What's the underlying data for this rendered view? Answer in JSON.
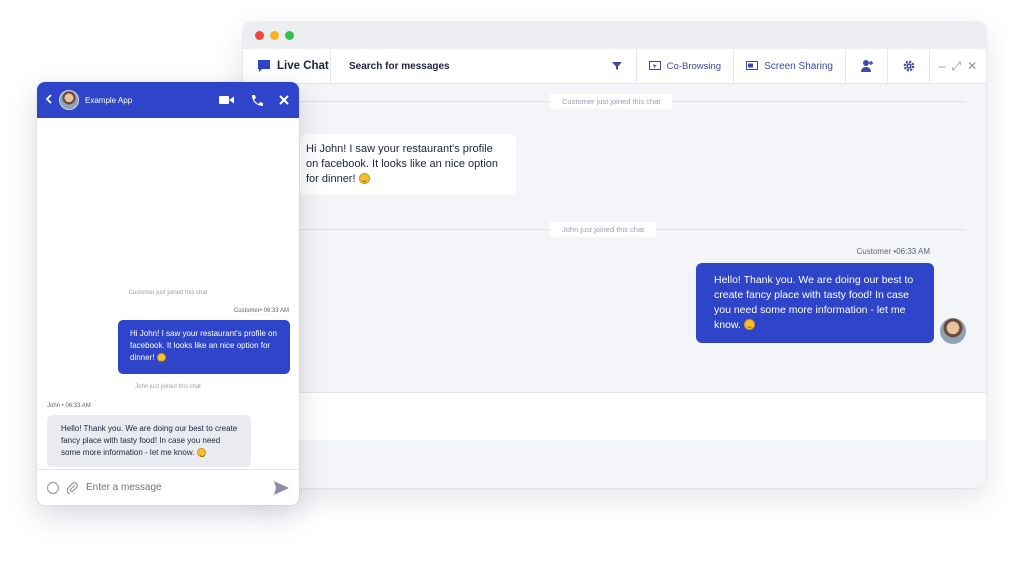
{
  "desktop": {
    "toolbar": {
      "brand_label": "Live Chat",
      "search_label": "Search for messages",
      "cobrowsing_label": "Co-Browsing",
      "screen_sharing_label": "Screen Sharing"
    },
    "system_notes": [
      "Customer just joined this chat",
      "John just joined this chat"
    ],
    "incoming_message": "Hi John! I saw your restaurant's profile on facebook. It looks like an nice option for dinner!",
    "outgoing_meta": "Customer •06:33 AM",
    "outgoing_message": "Hello! Thank you. We are doing our best to create fancy place with tasty food! In case you need some more information - let me know."
  },
  "mobile": {
    "header": {
      "title": "Example App"
    },
    "system_notes": [
      "Customer just joined this chat",
      "John just joined this chat"
    ],
    "customer_meta": "Customer• 06:33 AM",
    "customer_message": "Hi John! I saw your restaurant's profile on facebook. It looks like an nice option for dinner!",
    "agent_meta": "John • 06:33 AM",
    "agent_message": "Hello! Thank you. We are doing our best to create fancy place with tasty food! In case you need some more information - let me know.",
    "composer": {
      "placeholder": "Enter a message"
    }
  },
  "colors": {
    "accent": "#2f45c9",
    "window_bg": "#f4f5f8",
    "incoming_bubble": "#e9ebf0"
  },
  "icons": [
    "chat-icon",
    "filter-icon",
    "cobrowsing-icon",
    "screen-sharing-icon",
    "add-user-icon",
    "gear-icon",
    "minimize-icon",
    "expand-icon",
    "close-icon",
    "back-icon",
    "video-icon",
    "phone-icon",
    "emoji-icon",
    "attach-icon",
    "send-icon"
  ]
}
